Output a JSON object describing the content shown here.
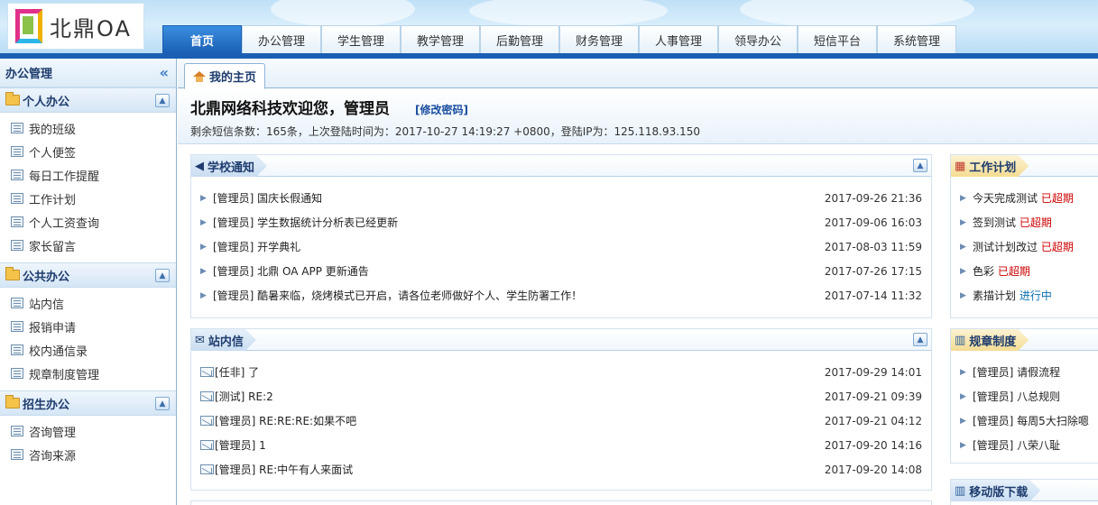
{
  "header": {
    "logo_text": "北鼎OA",
    "nav": [
      "首页",
      "办公管理",
      "学生管理",
      "教学管理",
      "后勤管理",
      "财务管理",
      "人事管理",
      "领导办公",
      "短信平台",
      "系统管理"
    ]
  },
  "sidebar": {
    "title": "办公管理",
    "groups": [
      {
        "label": "个人办公",
        "items": [
          "我的班级",
          "个人便签",
          "每日工作提醒",
          "工作计划",
          "个人工资查询",
          "家长留言"
        ]
      },
      {
        "label": "公共办公",
        "items": [
          "站内信",
          "报销申请",
          "校内通信录",
          "规章制度管理"
        ]
      },
      {
        "label": "招生办公",
        "items": [
          "咨询管理",
          "咨询来源"
        ]
      }
    ]
  },
  "content": {
    "tab": "我的主页",
    "welcome": "北鼎网络科技欢迎您，管理员",
    "change_password": "[修改密码]",
    "info": "剩余短信条数：165条，上次登陆时间为：2017-10-27 14:19:27 +0800，登陆IP为：125.118.93.150"
  },
  "notice": {
    "title": "学校通知",
    "rows": [
      {
        "text": "[管理员] 国庆长假通知",
        "date": "2017-09-26 21:36"
      },
      {
        "text": "[管理员] 学生数据统计分析表已经更新",
        "date": "2017-09-06 16:03"
      },
      {
        "text": "[管理员] 开学典礼",
        "date": "2017-08-03 11:59"
      },
      {
        "text": "[管理员] 北鼎 OA APP 更新通告",
        "date": "2017-07-26 17:15"
      },
      {
        "text": "[管理员] 酷暑来临，烧烤模式已开启，请各位老师做好个人、学生防署工作！",
        "date": "2017-07-14 11:32"
      }
    ]
  },
  "mail": {
    "title": "站内信",
    "rows": [
      {
        "text": "[任非] 了",
        "date": "2017-09-29 14:01"
      },
      {
        "text": "[测试] RE:2",
        "date": "2017-09-21 09:39"
      },
      {
        "text": "[管理员] RE:RE:RE:如果不吧",
        "date": "2017-09-21 04:12"
      },
      {
        "text": "[管理员] 1",
        "date": "2017-09-20 14:16"
      },
      {
        "text": "[管理员] RE:中午有人来面试",
        "date": "2017-09-20 14:08"
      }
    ]
  },
  "plan": {
    "title": "工作计划",
    "rows": [
      {
        "text": "今天完成测试",
        "status": "已超期"
      },
      {
        "text": "签到测试",
        "status": "已超期"
      },
      {
        "text": "测试计划改过",
        "status": "已超期"
      },
      {
        "text": "色彩",
        "status": "已超期"
      },
      {
        "text": "素描计划",
        "status": "进行中"
      }
    ]
  },
  "rules": {
    "title": "规章制度",
    "rows": [
      "[管理员] 请假流程",
      "[管理员] 八总规则",
      "[管理员] 每周5大扫除嗯",
      "[管理员] 八荣八耻"
    ]
  },
  "mobile": {
    "title": "移动版下载"
  }
}
